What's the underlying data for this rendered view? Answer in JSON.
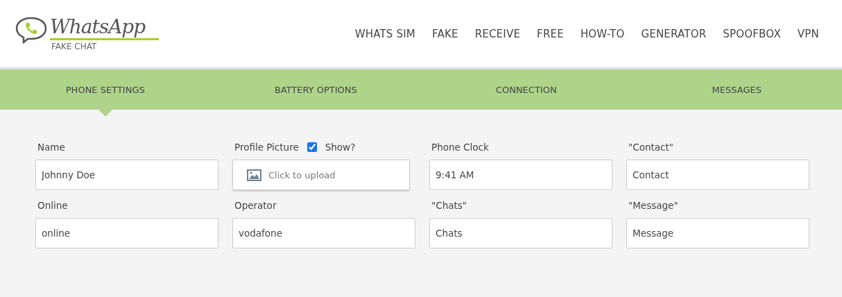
{
  "logo": {
    "title": "WhatsApp",
    "subtitle": "FAKE CHAT"
  },
  "nav": [
    "WHATS SIM",
    "FAKE",
    "RECEIVE",
    "FREE",
    "HOW-TO",
    "GENERATOR",
    "SPOOFBOX",
    "VPN"
  ],
  "tabs": [
    {
      "label": "PHONE SETTINGS",
      "selected": true
    },
    {
      "label": "BATTERY OPTIONS",
      "selected": false
    },
    {
      "label": "CONNECTION",
      "selected": false
    },
    {
      "label": "MESSAGES",
      "selected": false
    }
  ],
  "fields": [
    {
      "kind": "text",
      "label": "Name",
      "value": "Johnny Doe"
    },
    {
      "kind": "upload",
      "label": "Profile Picture",
      "checkbox": {
        "label": "Show?",
        "checked": true
      },
      "button": "Click to upload"
    },
    {
      "kind": "text",
      "label": "Phone Clock",
      "value": "9:41 AM"
    },
    {
      "kind": "text",
      "label": "\"Contact\"",
      "value": "Contact"
    },
    {
      "kind": "text",
      "label": "Online",
      "value": "online"
    },
    {
      "kind": "text",
      "label": "Operator",
      "value": "vodafone"
    },
    {
      "kind": "text",
      "label": "\"Chats\"",
      "value": "Chats"
    },
    {
      "kind": "text",
      "label": "\"Message\"",
      "value": "Message"
    }
  ]
}
